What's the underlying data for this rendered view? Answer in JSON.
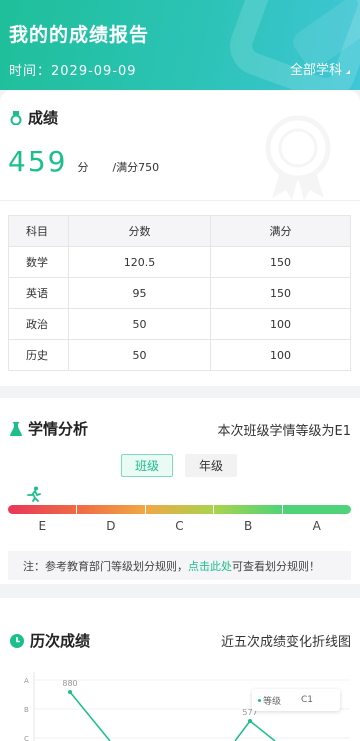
{
  "header": {
    "title": "我的的成绩报告",
    "date": "时间：2029-09-09",
    "filter_label": "全部学科"
  },
  "score": {
    "section_title": "成绩",
    "value": "459",
    "unit": "分",
    "full": "/满分750",
    "table_headers": [
      "科目",
      "分数",
      "满分"
    ],
    "rows": [
      {
        "subject": "数学",
        "score": "120.5",
        "full": "150"
      },
      {
        "subject": "英语",
        "score": "95",
        "full": "150"
      },
      {
        "subject": "政治",
        "score": "50",
        "full": "100"
      },
      {
        "subject": "历史",
        "score": "50",
        "full": "100"
      }
    ]
  },
  "analysis": {
    "section_title": "学情分析",
    "summary": "本次班级学情等级为E1",
    "tabs": [
      "班级",
      "年级"
    ],
    "active_tab": "班级",
    "grades": [
      "E",
      "D",
      "C",
      "B",
      "A"
    ],
    "grade_colors": [
      "#e8375a",
      "#ef6a45",
      "#f0a845",
      "#a9d34d",
      "#4fd37a"
    ],
    "current_grade": "E1",
    "note_prefix": "注：参考教育部门等级划分规则，",
    "note_link": "点击此处",
    "note_suffix": "可查看划分规则！"
  },
  "history": {
    "section_title": "历次成绩",
    "subtitle": "近五次成绩变化折线图",
    "chart_data": {
      "type": "line",
      "y_categories": [
        "A",
        "B",
        "C"
      ],
      "points": [
        {
          "label": "880",
          "grade": "A"
        },
        {
          "label": "577",
          "grade": "B"
        }
      ],
      "legend": {
        "series": "等级",
        "value": "C1"
      }
    }
  },
  "colors": {
    "accent": "#1bbf8c",
    "header_start": "#1fbf9a",
    "header_end": "#3fc6d7"
  }
}
